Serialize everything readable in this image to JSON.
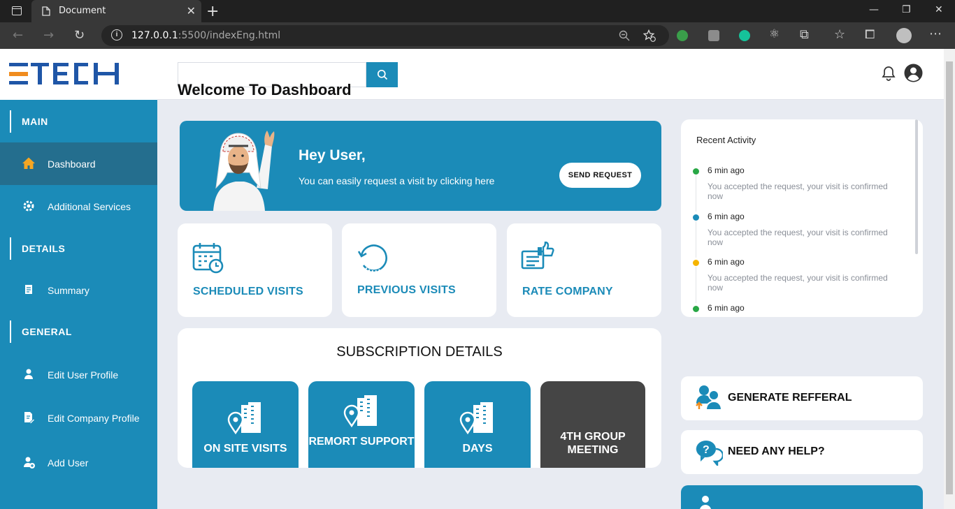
{
  "browser": {
    "tab_title": "Document",
    "url_host": "127.0.0.1",
    "url_rest": ":5500/indexEng.html"
  },
  "brand": {
    "logo_text": "ETECH",
    "primary": "#1b8bb8",
    "accent": "#f08c1e"
  },
  "sidebar": {
    "sections": [
      "MAIN",
      "DETAILS",
      "GENERAL"
    ],
    "items": [
      {
        "label": "Dashboard",
        "icon": "home-icon",
        "active": true
      },
      {
        "label": "Additional Services",
        "icon": "gear-icon"
      },
      {
        "label": "Summary",
        "icon": "document-icon"
      },
      {
        "label": "Edit User Profile",
        "icon": "user-icon"
      },
      {
        "label": "Edit Company Profile",
        "icon": "edit-document-icon"
      },
      {
        "label": "Add User",
        "icon": "add-user-icon"
      }
    ]
  },
  "header": {
    "search_placeholder": ""
  },
  "main": {
    "title": "Welcome To Dashboard",
    "hero": {
      "greeting": "Hey User,",
      "subtitle": "You can easily request a visit by clicking here",
      "button": "SEND REQUEST"
    },
    "cards": [
      {
        "label": "SCHEDULED VISITS",
        "icon": "calendar-clock-icon"
      },
      {
        "label": "PREVIOUS VISITS",
        "icon": "refresh-icon"
      },
      {
        "label": "RATE COMPANY",
        "icon": "thumbs-up-feedback-icon"
      }
    ],
    "subscription": {
      "title": "SUBSCRIPTION DETAILS",
      "tiles": [
        {
          "label": "ON SITE VISITS"
        },
        {
          "label": "REMORT SUPPORT"
        },
        {
          "label": "DAYS"
        },
        {
          "label": "4TH GROUP MEETING"
        }
      ]
    }
  },
  "activity": {
    "title": "Recent Activity",
    "items": [
      {
        "time": "6 min ago",
        "message": "You accepted the request, your visit is confirmed now",
        "color": "#28a745"
      },
      {
        "time": "6 min ago",
        "message": "You accepted the request, your visit is confirmed now",
        "color": "#1b8bb8"
      },
      {
        "time": "6 min ago",
        "message": "You accepted the request, your visit is confirmed now",
        "color": "#f5b400"
      },
      {
        "time": "6 min ago",
        "message": "",
        "color": "#28a745"
      }
    ]
  },
  "right_cards": {
    "referral": "GENERATE REFFERAL",
    "help": "NEED ANY HELP?"
  }
}
